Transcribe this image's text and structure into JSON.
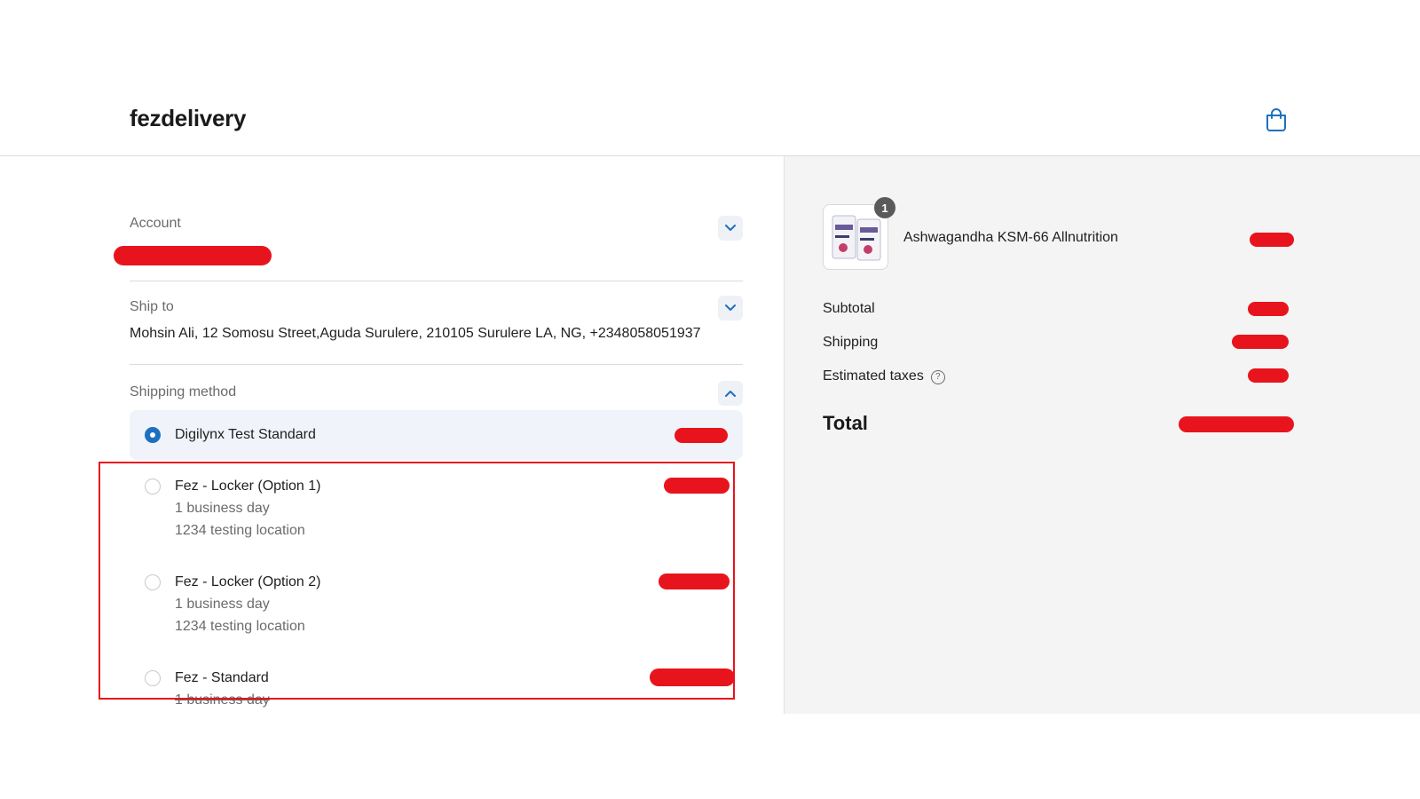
{
  "header": {
    "store_name": "fezdelivery",
    "cart_icon": "shopping-bag-icon"
  },
  "account": {
    "label": "Account",
    "value_redacted": true
  },
  "ship_to": {
    "label": "Ship to",
    "address": "Mohsin Ali, 12 Somosu Street,Aguda Surulere, 210105 Surulere LA, NG, +2348058051937"
  },
  "shipping_method": {
    "label": "Shipping method",
    "options": [
      {
        "title": "Digilynx Test Standard",
        "line1": "",
        "line2": "",
        "selected": true
      },
      {
        "title": "Fez - Locker (Option 1)",
        "line1": "1 business day",
        "line2": "1234 testing location",
        "selected": false
      },
      {
        "title": "Fez - Locker (Option 2)",
        "line1": "1 business day",
        "line2": "1234 testing location",
        "selected": false
      },
      {
        "title": "Fez - Standard",
        "line1": "1 business day",
        "line2": "",
        "selected": false
      }
    ]
  },
  "summary": {
    "product": {
      "name": "Ashwagandha KSM-66 Allnutrition",
      "quantity": "1"
    },
    "subtotal_label": "Subtotal",
    "shipping_label": "Shipping",
    "taxes_label": "Estimated taxes",
    "taxes_help_icon": "question-circle-icon",
    "total_label": "Total"
  },
  "colors": {
    "accent": "#1e6fbf",
    "redaction": "#e8141d",
    "summary_bg": "#f4f4f4"
  }
}
